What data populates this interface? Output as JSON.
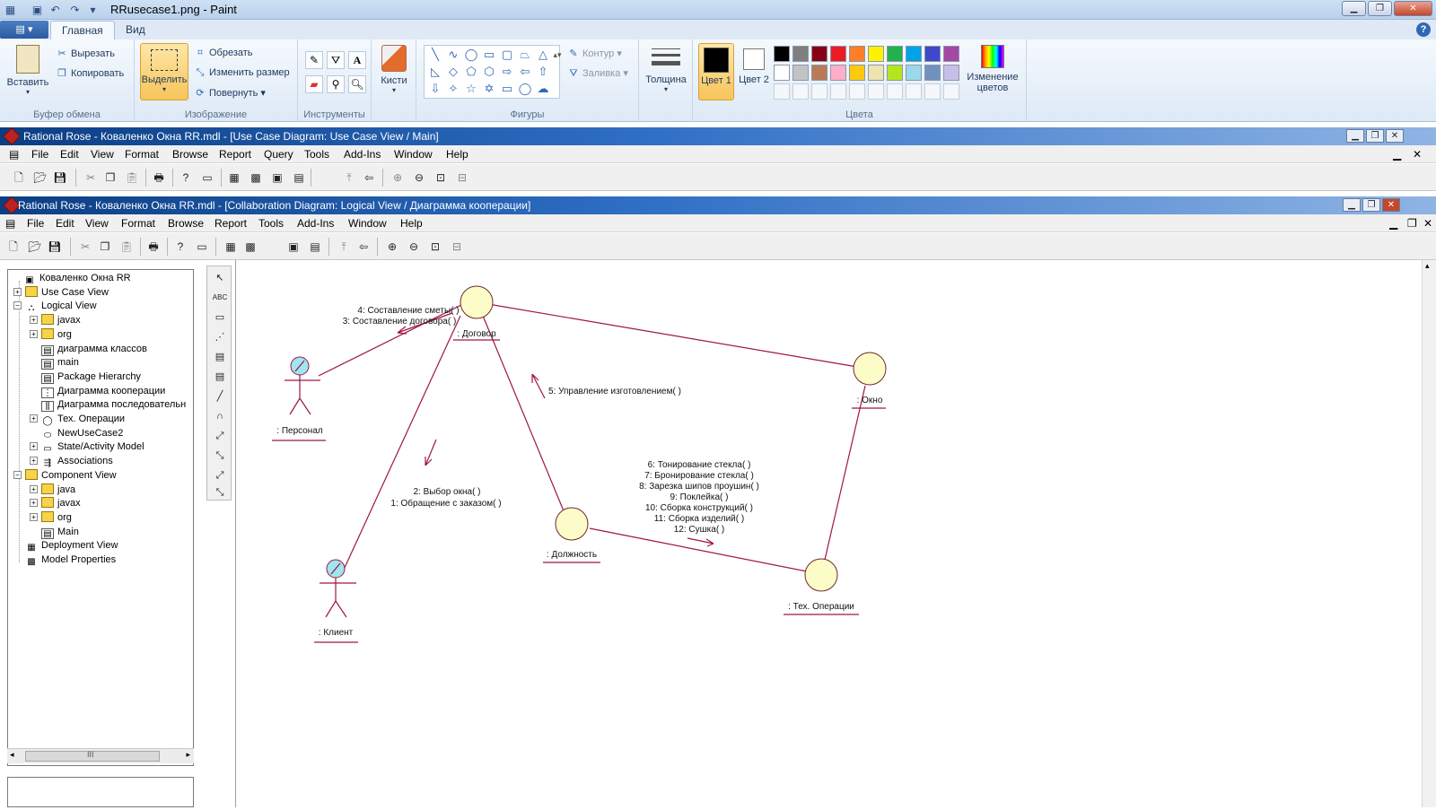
{
  "paint": {
    "title": "RRusecase1.png - Paint",
    "tabs": [
      "Главная",
      "Вид"
    ],
    "clipboard": {
      "paste": "Вставить",
      "cut": "Вырезать",
      "copy": "Копировать",
      "group": "Буфер обмена"
    },
    "image": {
      "select": "Выделить",
      "crop": "Обрезать",
      "resize": "Изменить размер",
      "rotate": "Повернуть",
      "group": "Изображение"
    },
    "tools": {
      "group": "Инструменты",
      "brushes": "Кисти"
    },
    "shapes": {
      "outline": "Контур",
      "fill": "Заливка",
      "group": "Фигуры"
    },
    "size": {
      "label": "Толщина"
    },
    "colors": {
      "color1": "Цвет 1",
      "color2": "Цвет 2",
      "edit": "Изменение цветов",
      "group": "Цвета",
      "palette_row1": [
        "#000000",
        "#7f7f7f",
        "#880015",
        "#ed1c24",
        "#ff7f27",
        "#fff200",
        "#22b14c",
        "#00a2e8",
        "#3f48cc",
        "#a349a4"
      ],
      "palette_row2": [
        "#ffffff",
        "#c3c3c3",
        "#b97a57",
        "#ffaec9",
        "#ffc90e",
        "#efe4b0",
        "#b5e61d",
        "#99d9ea",
        "#7092be",
        "#c8bfe7"
      ]
    }
  },
  "rose_back": {
    "title": "Rational Rose - Коваленко Окна RR.mdl - [Use Case Diagram: Use Case View / Main]"
  },
  "rose": {
    "title": "Rational Rose - Коваленко Окна RR.mdl - [Collaboration Diagram: Logical View / Диаграмма кооперации]",
    "menu": [
      "File",
      "Edit",
      "View",
      "Format",
      "Browse",
      "Report",
      "Query",
      "Tools",
      "Add-Ins",
      "Window",
      "Help"
    ],
    "menu_front": [
      "File",
      "Edit",
      "View",
      "Format",
      "Browse",
      "Report",
      "Tools",
      "Add-Ins",
      "Window",
      "Help"
    ]
  },
  "browser": {
    "tree": [
      {
        "label": "Коваленко Окна RR",
        "icon": "model-icon",
        "level": 0,
        "expander": ""
      },
      {
        "label": "Use Case View",
        "icon": "folder-icon",
        "level": 1,
        "expander": "+"
      },
      {
        "label": "Logical View",
        "icon": "logical-view-icon",
        "level": 1,
        "expander": "-"
      },
      {
        "label": "javax",
        "icon": "folder-icon",
        "level": 2,
        "expander": "+"
      },
      {
        "label": "org",
        "icon": "folder-icon",
        "level": 2,
        "expander": "+"
      },
      {
        "label": "диаграмма классов",
        "icon": "class-diagram-icon",
        "level": 2,
        "expander": ""
      },
      {
        "label": "main",
        "icon": "class-diagram-icon",
        "level": 2,
        "expander": ""
      },
      {
        "label": "Package Hierarchy",
        "icon": "class-diagram-icon",
        "level": 2,
        "expander": ""
      },
      {
        "label": "Диаграмма кооперации",
        "icon": "collaboration-diagram-icon",
        "level": 2,
        "expander": ""
      },
      {
        "label": "Диаграмма последовательн",
        "icon": "sequence-diagram-icon",
        "level": 2,
        "expander": ""
      },
      {
        "label": "Тех. Операции",
        "icon": "class-icon",
        "level": 2,
        "expander": "+"
      },
      {
        "label": "NewUseCase2",
        "icon": "use-case-icon",
        "level": 2,
        "expander": ""
      },
      {
        "label": "State/Activity Model",
        "icon": "state-model-icon",
        "level": 2,
        "expander": "+"
      },
      {
        "label": "Associations",
        "icon": "associations-icon",
        "level": 2,
        "expander": "+"
      },
      {
        "label": "Component View",
        "icon": "folder-icon",
        "level": 1,
        "expander": "-"
      },
      {
        "label": "java",
        "icon": "folder-icon",
        "level": 2,
        "expander": "+"
      },
      {
        "label": "javax",
        "icon": "folder-icon",
        "level": 2,
        "expander": "+"
      },
      {
        "label": "org",
        "icon": "folder-icon",
        "level": 2,
        "expander": "+"
      },
      {
        "label": "Main",
        "icon": "component-diagram-icon",
        "level": 2,
        "expander": ""
      },
      {
        "label": "Deployment View",
        "icon": "deployment-icon",
        "level": 1,
        "expander": ""
      },
      {
        "label": "Model Properties",
        "icon": "properties-icon",
        "level": 1,
        "expander": ""
      }
    ],
    "scroll_thumb": "III"
  },
  "diagram": {
    "objects": {
      "dogovor": ": Договор",
      "okno": ": Окно",
      "dolzhnost": ": Должность",
      "tech": ": Тех. Операции",
      "personal": ": Персонал",
      "klient": ": Клиент"
    },
    "messages": {
      "m4": "4: Составление сметы( )",
      "m3": "3: Составление договора( )",
      "m5": "5: Управление изготовлением( )",
      "m2": "2: Выбор окна( )",
      "m1": "1: Обращение с заказом( )",
      "m6": "6: Тонирование стекла( )",
      "m7": "7: Бронирование стекла( )",
      "m8": "8: Зарезка шипов проушин( )",
      "m9": "9: Поклейка( )",
      "m10": "10: Сборка конструкций( )",
      "m11": "11: Сборка изделий( )",
      "m12": "12: Сушка( )"
    },
    "colors": {
      "link": "#a0144a",
      "object_fill": "#fcfcc8",
      "actor_head": "#9fe6ee"
    }
  }
}
